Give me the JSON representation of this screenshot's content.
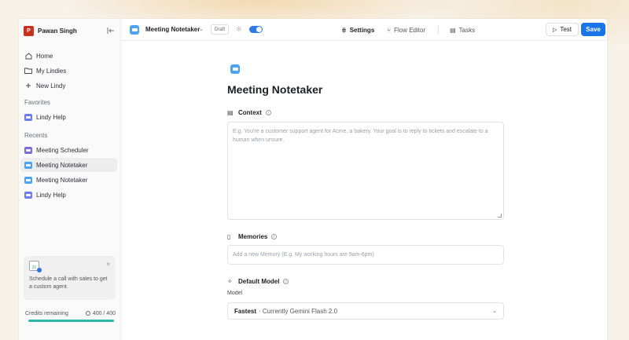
{
  "user": {
    "initial": "P",
    "name": "Pawan Singh"
  },
  "sidebar": {
    "nav": [
      {
        "label": "Home",
        "icon": "home-icon"
      },
      {
        "label": "My Lindies",
        "icon": "folder-icon"
      },
      {
        "label": "New Lindy",
        "icon": "plus-icon"
      }
    ],
    "favorites_label": "Favorites",
    "favorites": [
      {
        "label": "Lindy Help",
        "color": "#6b7cf0"
      }
    ],
    "recents_label": "Recents",
    "recents": [
      {
        "label": "Meeting Scheduler",
        "color": "#7c6bdc"
      },
      {
        "label": "Meeting Notetaker",
        "color": "#4da3f0"
      },
      {
        "label": "Meeting Notetaker",
        "color": "#4da3f0"
      },
      {
        "label": "Lindy Help",
        "color": "#6b7cf0"
      }
    ],
    "promo": {
      "cal_text": "31",
      "text": "Schedule a call with sales to get a custom agent.",
      "close": "×"
    },
    "credits": {
      "label": "Credits remaining",
      "value": "400 / 400",
      "fraction": 1.0
    }
  },
  "topbar": {
    "agent_title": "Meeting Notetaker",
    "caret": "⌄",
    "status": "Draft",
    "toggle_on": true,
    "tabs": [
      {
        "label": "Settings",
        "icon": "⋕",
        "active": true
      },
      {
        "label": "Flow Editor",
        "icon": "⑂",
        "active": false
      },
      {
        "label": "Tasks",
        "icon": "▤",
        "active": false
      }
    ],
    "test_label": "Test",
    "save_label": "Save"
  },
  "main": {
    "title": "Meeting Notetaker",
    "context": {
      "label": "Context",
      "placeholder": "E.g. You're a customer support agent for Acme, a bakery. Your goal is to reply to tickets and escalate to a human when unsure."
    },
    "memories": {
      "label": "Memories",
      "placeholder": "Add a new Memory (E.g. My working hours are 9am-6pm)"
    },
    "model": {
      "label": "Default Model",
      "sub_label": "Model",
      "selected_name": "Fastest",
      "selected_detail": "· Currently Gemini Flash 2.0"
    }
  },
  "colors": {
    "accent": "#1a73e8",
    "avatar": "#c8331f",
    "credit_bar": "#2bb7a8"
  }
}
